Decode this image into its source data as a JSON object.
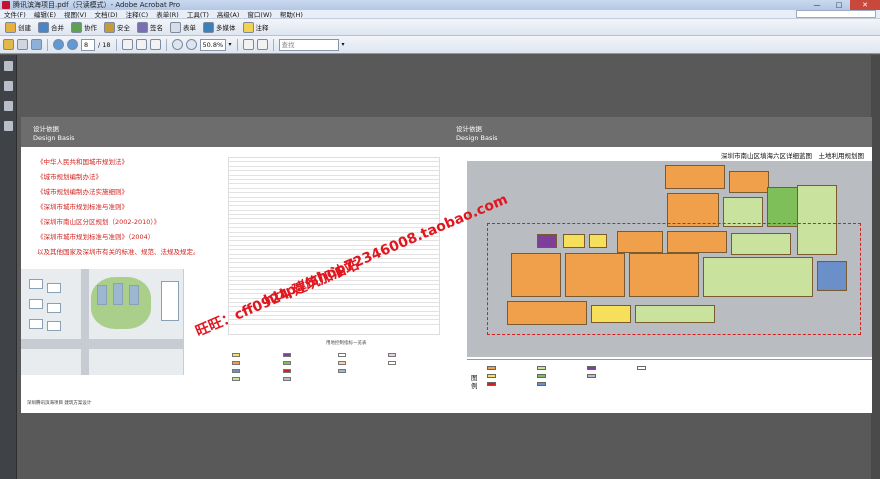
{
  "window": {
    "title": "腾讯滨海项目.pdf（只读模式）- Adobe Acrobat Pro",
    "minimize": "—",
    "maximize": "□",
    "close": "✕"
  },
  "menu": [
    "文件(F)",
    "编辑(E)",
    "视图(V)",
    "文档(D)",
    "注释(C)",
    "表单(R)",
    "工具(T)",
    "高级(A)",
    "窗口(W)",
    "帮助(H)"
  ],
  "toolbar1": [
    {
      "label": "创建",
      "icon": "create-pdf-icon"
    },
    {
      "label": "合并",
      "icon": "combine-icon"
    },
    {
      "label": "协作",
      "icon": "collaborate-icon"
    },
    {
      "label": "安全",
      "icon": "lock-icon"
    },
    {
      "label": "签名",
      "icon": "sign-icon"
    },
    {
      "label": "表单",
      "icon": "forms-icon"
    },
    {
      "label": "多媒体",
      "icon": "multimedia-icon"
    },
    {
      "label": "注释",
      "icon": "comment-icon"
    }
  ],
  "toolbar2": {
    "page_current": "8",
    "page_total": "/ 18",
    "zoom": "50.8%",
    "search_placeholder": "查找"
  },
  "page": {
    "left_heading_cn": "设计依据",
    "left_heading_en": "Design Basis",
    "right_heading_cn": "设计依据",
    "right_heading_en": "Design Basis",
    "basis_items": [
      "《中华人民共和国城市规划法》",
      "《城市规划编制办法》",
      "《城市规划编制办法实施细则》",
      "《深圳市城市规划标准与准则》",
      "《深圳市南山区分区规划（2002-2010）》",
      "《深圳市城市规划标准与准则》（2004）",
      "以及其他国家及深圳市有关的标准、规范、法规及规定。"
    ],
    "table_caption": "用地控制指标一览表",
    "right_title": "深圳市南山区填海六区详细蓝图　土地利用规划图",
    "legend_label": "图例",
    "footer_left": "深圳腾讯滨海项目 建筑方案设计"
  },
  "watermark": {
    "line1": "旺旺：cff0924 建筑加油站",
    "line2": "http://shop72346008.taobao.com"
  },
  "colors": {
    "accent_red": "#d0231f",
    "watermark_red": "#e1161e"
  }
}
